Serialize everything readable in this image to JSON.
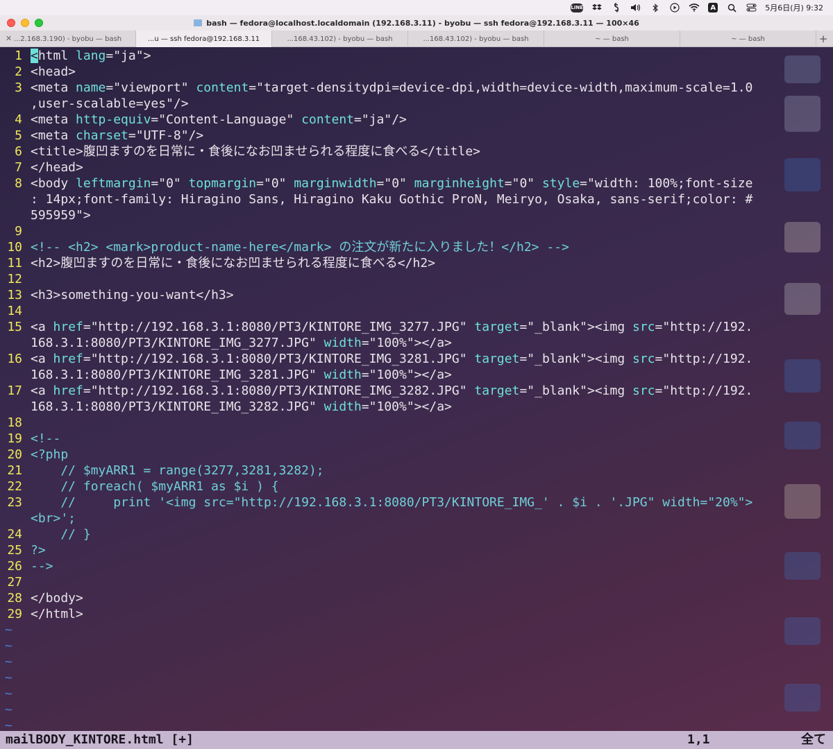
{
  "menubar": {
    "icons": [
      "line-icon",
      "dropbox-icon",
      "script-icon",
      "volume-icon",
      "bluetooth-icon",
      "play-icon",
      "wifi-icon",
      "input-method-icon",
      "search-icon",
      "control-center-icon"
    ],
    "line_label": "LINE",
    "input_label": "A",
    "datetime": "5月6日(月) 9:32"
  },
  "window": {
    "title": "bash — fedora@localhost.localdomain (192.168.3.11) - byobu — ssh fedora@192.168.3.11 — 100×46"
  },
  "tabs": [
    {
      "label": "...2.168.3.190) - byobu — bash",
      "active": false
    },
    {
      "label": "...u — ssh fedora@192.168.3.11",
      "active": true
    },
    {
      "label": "...168.43.102) - byobu — bash",
      "active": false
    },
    {
      "label": "...168.43.102) - byobu — bash",
      "active": false
    },
    {
      "label": "~ — bash",
      "active": false
    },
    {
      "label": "~ — bash",
      "active": false
    }
  ],
  "tab_add": "+",
  "editor": {
    "lines": [
      {
        "n": "1",
        "text": "<html lang=\"ja\">"
      },
      {
        "n": "2",
        "text": "<head>"
      },
      {
        "n": "3",
        "text": "<meta name=\"viewport\" content=\"target-densitydpi=device-dpi,width=device-width,maximum-scale=1.0"
      },
      {
        "n": "",
        "text": ",user-scalable=yes\"/>"
      },
      {
        "n": "4",
        "text": "<meta http-equiv=\"Content-Language\" content=\"ja\"/>"
      },
      {
        "n": "5",
        "text": "<meta charset=\"UTF-8\"/>"
      },
      {
        "n": "6",
        "text": "<title>腹凹ますのを日常に・食後になお凹ませられる程度に食べる</title>"
      },
      {
        "n": "7",
        "text": "</head>"
      },
      {
        "n": "8",
        "text": "<body leftmargin=\"0\" topmargin=\"0\" marginwidth=\"0\" marginheight=\"0\" style=\"width: 100%;font-size"
      },
      {
        "n": "",
        "text": ": 14px;font-family: Hiragino Sans, Hiragino Kaku Gothic ProN, Meiryo, Osaka, sans-serif;color: #"
      },
      {
        "n": "",
        "text": "595959\">"
      },
      {
        "n": "9",
        "text": ""
      },
      {
        "n": "10",
        "text": "<!-- <h2> <mark>product-name-here</mark> の注文が新たに入りました！</h2> -->"
      },
      {
        "n": "11",
        "text": "<h2>腹凹ますのを日常に・食後になお凹ませられる程度に食べる</h2>"
      },
      {
        "n": "12",
        "text": ""
      },
      {
        "n": "13",
        "text": "<h3>something-you-want</h3>"
      },
      {
        "n": "14",
        "text": ""
      },
      {
        "n": "15",
        "text": "<a href=\"http://192.168.3.1:8080/PT3/KINTORE_IMG_3277.JPG\" target=\"_blank\"><img src=\"http://192."
      },
      {
        "n": "",
        "text": "168.3.1:8080/PT3/KINTORE_IMG_3277.JPG\" width=\"100%\"></a>"
      },
      {
        "n": "16",
        "text": "<a href=\"http://192.168.3.1:8080/PT3/KINTORE_IMG_3281.JPG\" target=\"_blank\"><img src=\"http://192."
      },
      {
        "n": "",
        "text": "168.3.1:8080/PT3/KINTORE_IMG_3281.JPG\" width=\"100%\"></a>"
      },
      {
        "n": "17",
        "text": "<a href=\"http://192.168.3.1:8080/PT3/KINTORE_IMG_3282.JPG\" target=\"_blank\"><img src=\"http://192."
      },
      {
        "n": "",
        "text": "168.3.1:8080/PT3/KINTORE_IMG_3282.JPG\" width=\"100%\"></a>"
      },
      {
        "n": "18",
        "text": ""
      },
      {
        "n": "19",
        "text": "<!--"
      },
      {
        "n": "20",
        "text": "<?php"
      },
      {
        "n": "21",
        "text": "    // $myARR1 = range(3277,3281,3282);"
      },
      {
        "n": "22",
        "text": "    // foreach( $myARR1 as $i ) {"
      },
      {
        "n": "23",
        "text": "    //     print '<img src=\"http://192.168.3.1:8080/PT3/KINTORE_IMG_' . $i . '.JPG\" width=\"20%\">"
      },
      {
        "n": "",
        "text": "<br>';"
      },
      {
        "n": "24",
        "text": "    // }"
      },
      {
        "n": "25",
        "text": "?>"
      },
      {
        "n": "26",
        "text": "-->"
      },
      {
        "n": "27",
        "text": ""
      },
      {
        "n": "28",
        "text": "</body>"
      },
      {
        "n": "29",
        "text": "</html>"
      }
    ],
    "tilde_count": 7,
    "tilde_char": "~"
  },
  "status": {
    "filename": "mailBODY_KINTORE.html [+]",
    "position": "1,1",
    "percent": "全て"
  },
  "colors": {
    "line_number": "#eee85a",
    "attribute": "#6fe0d8",
    "tilde": "#4a7fd8",
    "status_bg": "#c7b6cf"
  }
}
